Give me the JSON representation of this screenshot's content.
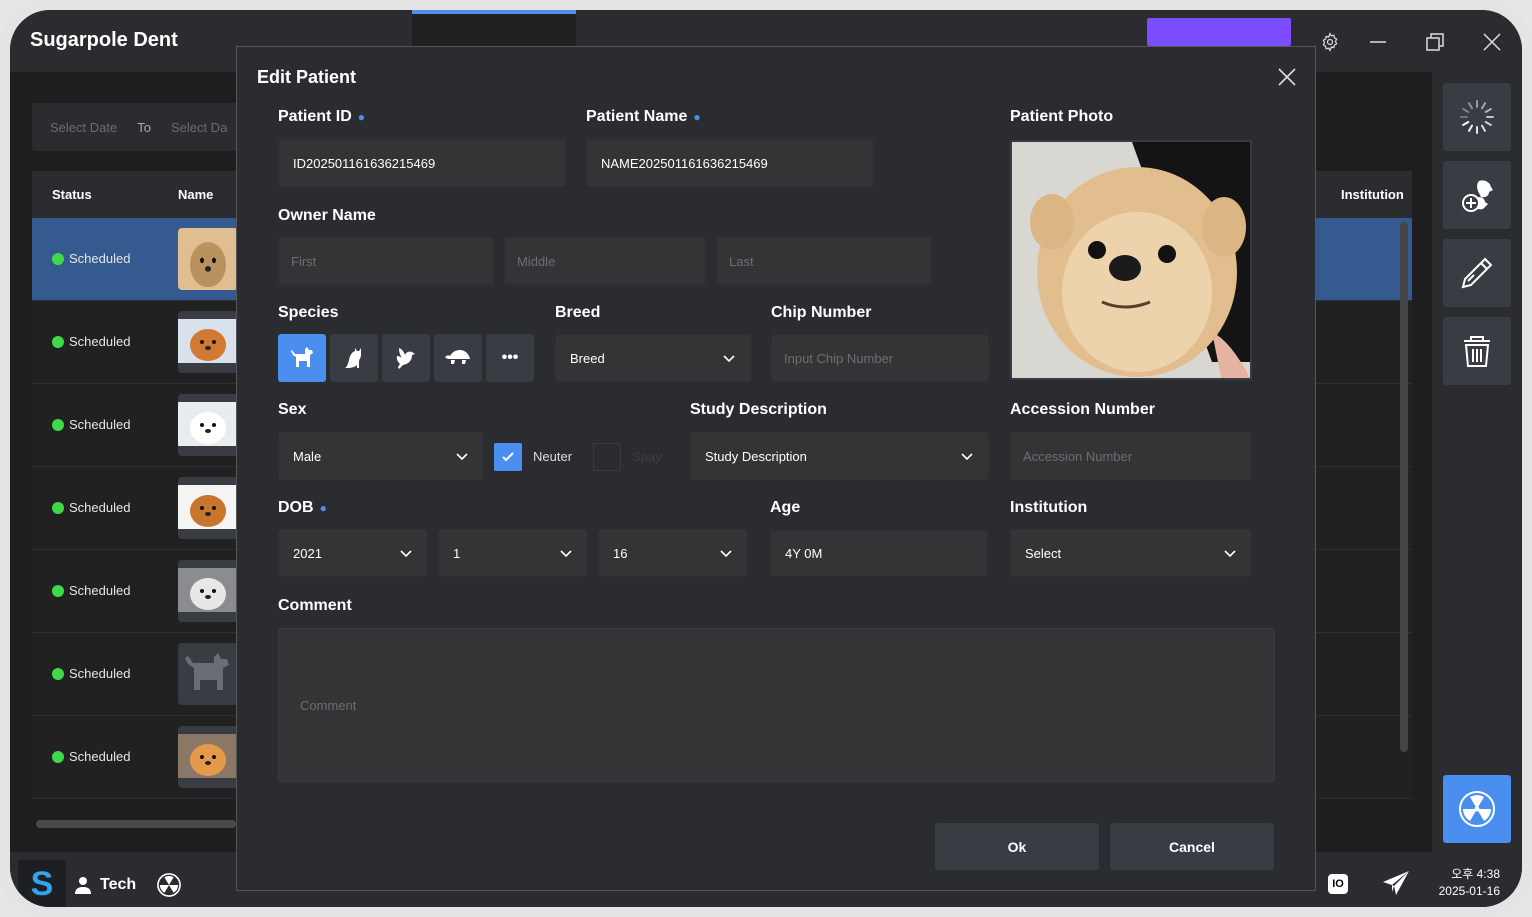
{
  "app": {
    "title": "Sugarpole Dent",
    "accent_color": "#4a8ff0",
    "selected_row_color": "#355a8f",
    "status_color": "#3fd94a"
  },
  "window_controls": [
    "settings",
    "minimize",
    "restore",
    "close"
  ],
  "filter": {
    "start_placeholder": "Select Date",
    "to_label": "To",
    "end_placeholder": "Select Da"
  },
  "table": {
    "columns": [
      "Status",
      "Name",
      "Institution"
    ],
    "rows": [
      {
        "status": "Scheduled",
        "thumbnail": "pomeranian-photo",
        "selected": true
      },
      {
        "status": "Scheduled",
        "thumbnail": "corgi-photo",
        "selected": false
      },
      {
        "status": "Scheduled",
        "thumbnail": "white-puppy-photo",
        "selected": false
      },
      {
        "status": "Scheduled",
        "thumbnail": "golden-retriever-photo",
        "selected": false
      },
      {
        "status": "Scheduled",
        "thumbnail": "cat-photo",
        "selected": false
      },
      {
        "status": "Scheduled",
        "thumbnail": "dog-placeholder-icon",
        "selected": false
      },
      {
        "status": "Scheduled",
        "thumbnail": "orange-cat-photo",
        "selected": false
      }
    ]
  },
  "right_toolbar": [
    "loading-spinner",
    "add-patient",
    "edit",
    "delete",
    "radiation"
  ],
  "bottombar": {
    "logo": "S",
    "user": "Tech",
    "time": "오후 4:38",
    "date": "2025-01-16"
  },
  "modal": {
    "title": "Edit Patient",
    "patient_id": {
      "label": "Patient ID",
      "value": "ID20250116163621546 9"
    },
    "patient_name": {
      "label": "Patient Name",
      "value": "NAME20250116163621546 9"
    },
    "patient_photo": {
      "label": "Patient Photo"
    },
    "owner_name": {
      "label": "Owner Name",
      "first_placeholder": "First",
      "middle_placeholder": "Middle",
      "last_placeholder": "Last"
    },
    "species": {
      "label": "Species",
      "options": [
        "dog",
        "cat",
        "bird",
        "turtle",
        "more"
      ],
      "selected": "dog"
    },
    "breed": {
      "label": "Breed",
      "value": "Breed"
    },
    "chip_number": {
      "label": "Chip Number",
      "placeholder": "Input Chip Number"
    },
    "sex": {
      "label": "Sex",
      "value": "Male"
    },
    "neuter": {
      "label": "Neuter",
      "checked": true
    },
    "spay": {
      "label": "Spay",
      "checked": false
    },
    "study_description": {
      "label": "Study Description",
      "value": "Study Description"
    },
    "accession_number": {
      "label": "Accession Number",
      "placeholder": "Accession Number"
    },
    "dob": {
      "label": "DOB",
      "year": "2021",
      "month": "1",
      "day": "16"
    },
    "age": {
      "label": "Age",
      "value": "4Y 0M"
    },
    "institution": {
      "label": "Institution",
      "value": "Select"
    },
    "comment": {
      "label": "Comment",
      "placeholder": "Comment"
    },
    "ok_label": "Ok",
    "cancel_label": "Cancel"
  }
}
